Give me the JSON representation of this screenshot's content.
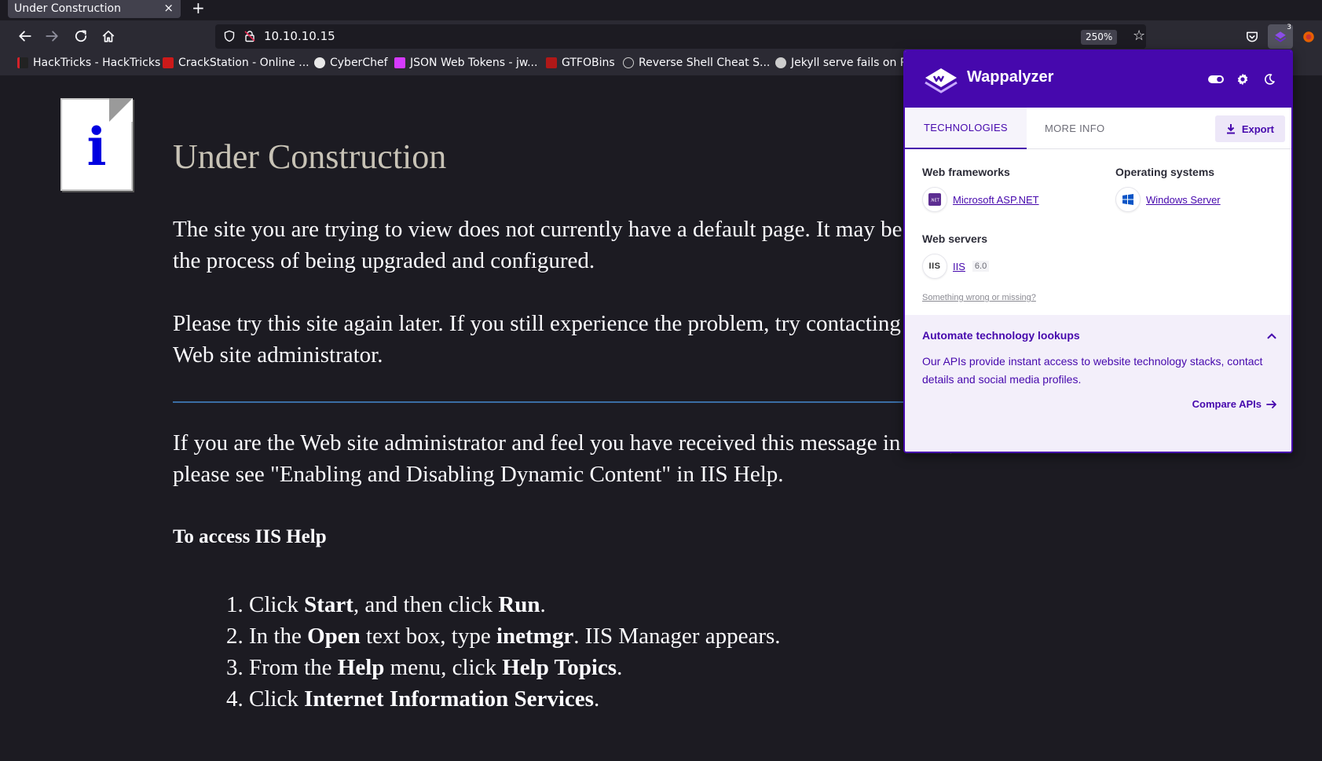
{
  "browser": {
    "tab_title": "Under Construction",
    "tab_close": "×",
    "new_tab": "+",
    "url": "10.10.10.15",
    "zoom": "250%",
    "extension_badge": "3",
    "bookmarks": [
      {
        "label": "HackTricks - HackTricks",
        "color": "#d3222a"
      },
      {
        "label": "CrackStation - Online ...",
        "color": "#cc1a1a"
      },
      {
        "label": "CyberChef",
        "color": "#e8e8e8"
      },
      {
        "label": "JSON Web Tokens - jw...",
        "color": "#d63aff"
      },
      {
        "label": "GTFOBins",
        "color": "#b01818"
      },
      {
        "label": "Reverse Shell Cheat S...",
        "color": "#cccccc"
      },
      {
        "label": "Jekyll serve fails on Ru",
        "color": "#cccccc"
      }
    ]
  },
  "page": {
    "title": "Under Construction",
    "para1": "The site you are trying to view does not currently have a default page. It may be in the process of being upgraded and configured.",
    "para2": "Please try this site again later. If you still experience the problem, try contacting the Web site administrator.",
    "para3": "If you are the Web site administrator and feel you have received this message in error, please see \"Enabling and Disabling Dynamic Content\" in IIS Help.",
    "help_heading": "To access IIS Help",
    "steps": [
      {
        "num": "1.",
        "a": "Click ",
        "b1": "Start",
        "c": ", and then click ",
        "b2": "Run",
        "d": "."
      },
      {
        "num": "2.",
        "a": "In the ",
        "b1": "Open",
        "c": " text box, type ",
        "b2": "inetmgr",
        "d": ". IIS Manager appears."
      },
      {
        "num": "3.",
        "a": "From the ",
        "b1": "Help",
        "c": " menu, click ",
        "b2": "Help Topics",
        "d": "."
      },
      {
        "num": "4.",
        "a": "Click ",
        "b1": "Internet Information Services",
        "c": "",
        "b2": "",
        "d": "."
      }
    ]
  },
  "wappalyzer": {
    "brand": "Wappalyzer",
    "tabs": {
      "technologies": "TECHNOLOGIES",
      "more_info": "MORE INFO"
    },
    "export_label": "Export",
    "categories": {
      "web_frameworks": {
        "title": "Web frameworks",
        "tech": "Microsoft ASP.NET",
        "icon": "aspnet-icon"
      },
      "operating_systems": {
        "title": "Operating systems",
        "tech": "Windows Server",
        "icon": "windows-icon"
      },
      "web_servers": {
        "title": "Web servers",
        "tech": "IIS",
        "version": "6.0",
        "icon_text": "IIS"
      }
    },
    "wrong_link": "Something wrong or missing?",
    "automate": {
      "title": "Automate technology lookups",
      "text": "Our APIs provide instant access to website technology stacks, contact details and social media profiles.",
      "cta": "Compare APIs"
    },
    "colors": {
      "brand": "#4608ad"
    }
  }
}
